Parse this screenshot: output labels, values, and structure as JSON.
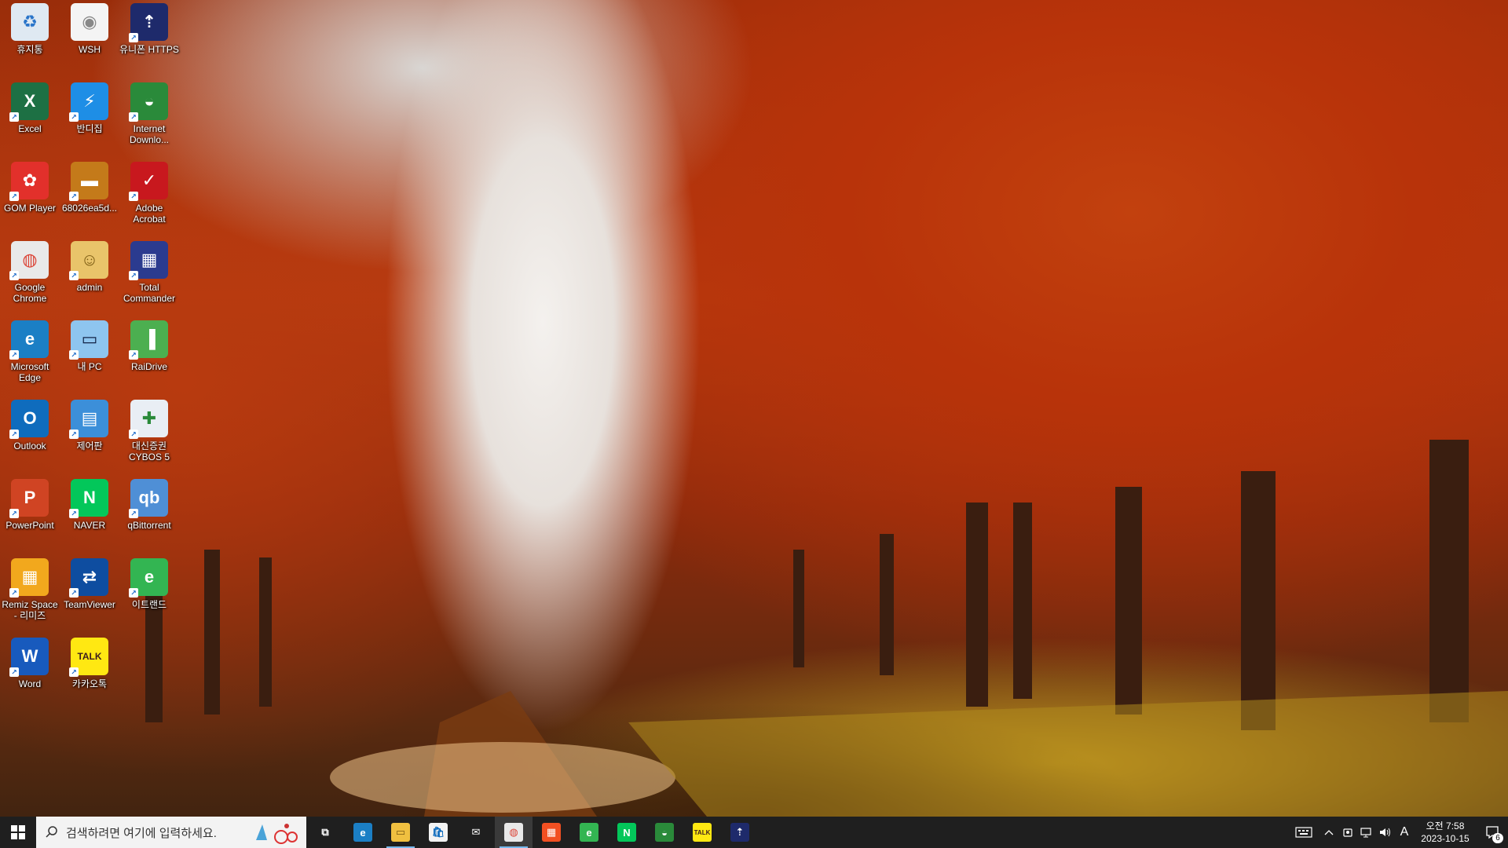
{
  "desktop": {
    "icons": [
      {
        "label": "휴지통",
        "icon": "recycle-bin-icon"
      },
      {
        "label": "WSH",
        "icon": "wsh-file-icon"
      },
      {
        "label": "유니폰 HTTPS",
        "icon": "https-icon"
      },
      {
        "label": "Excel",
        "icon": "excel-icon"
      },
      {
        "label": "반디집",
        "icon": "bandizip-icon"
      },
      {
        "label": "Internet Downlo...",
        "icon": "internet-download-manager-icon"
      },
      {
        "label": "GOM Player",
        "icon": "gom-player-icon"
      },
      {
        "label": "68026ea5d...",
        "icon": "image-file-icon"
      },
      {
        "label": "Adobe Acrobat",
        "icon": "adobe-acrobat-icon"
      },
      {
        "label": "Google Chrome",
        "icon": "chrome-icon"
      },
      {
        "label": "admin",
        "icon": "user-folder-icon"
      },
      {
        "label": "Total Commander",
        "icon": "total-commander-icon"
      },
      {
        "label": "Microsoft Edge",
        "icon": "edge-icon"
      },
      {
        "label": "내 PC",
        "icon": "this-pc-icon"
      },
      {
        "label": "RaiDrive",
        "icon": "raidrive-icon"
      },
      {
        "label": "Outlook",
        "icon": "outlook-icon"
      },
      {
        "label": "제어판",
        "icon": "control-panel-icon"
      },
      {
        "label": "대신증권 CYBOS 5",
        "icon": "cybos-icon"
      },
      {
        "label": "PowerPoint",
        "icon": "powerpoint-icon"
      },
      {
        "label": "NAVER",
        "icon": "naver-icon"
      },
      {
        "label": "qBittorrent",
        "icon": "qbittorrent-icon"
      },
      {
        "label": "Remiz Space - 리미즈",
        "icon": "remiz-space-icon"
      },
      {
        "label": "TeamViewer",
        "icon": "teamviewer-icon"
      },
      {
        "label": "이트랜드",
        "icon": "etland-icon"
      },
      {
        "label": "Word",
        "icon": "word-icon"
      },
      {
        "label": "카카오톡",
        "icon": "kakaotalk-icon"
      }
    ]
  },
  "taskbar": {
    "search_placeholder": "검색하려면 여기에 입력하세요.",
    "apps": [
      {
        "name": "task-view",
        "icon": "task-view-icon"
      },
      {
        "name": "edge",
        "icon": "edge-icon"
      },
      {
        "name": "file-explorer",
        "icon": "folder-icon"
      },
      {
        "name": "microsoft-store",
        "icon": "store-icon"
      },
      {
        "name": "mail",
        "icon": "mail-icon"
      },
      {
        "name": "chrome",
        "icon": "chrome-icon"
      },
      {
        "name": "microsoft-365",
        "icon": "windows-tiles-icon"
      },
      {
        "name": "etland",
        "icon": "etland-icon"
      },
      {
        "name": "naver",
        "icon": "naver-icon"
      },
      {
        "name": "internet-download-manager",
        "icon": "internet-download-manager-icon"
      },
      {
        "name": "kakaotalk",
        "icon": "kakaotalk-icon"
      },
      {
        "name": "unipon-https",
        "icon": "https-icon"
      }
    ],
    "tray": {
      "ime": "A",
      "time": "오전 7:58",
      "date": "2023-10-15",
      "notification_count": "6"
    }
  },
  "colors": {
    "taskbar_bg": "#1f1f1f",
    "search_bg": "#f3f3f3",
    "running_indicator": "#76b9ed"
  }
}
